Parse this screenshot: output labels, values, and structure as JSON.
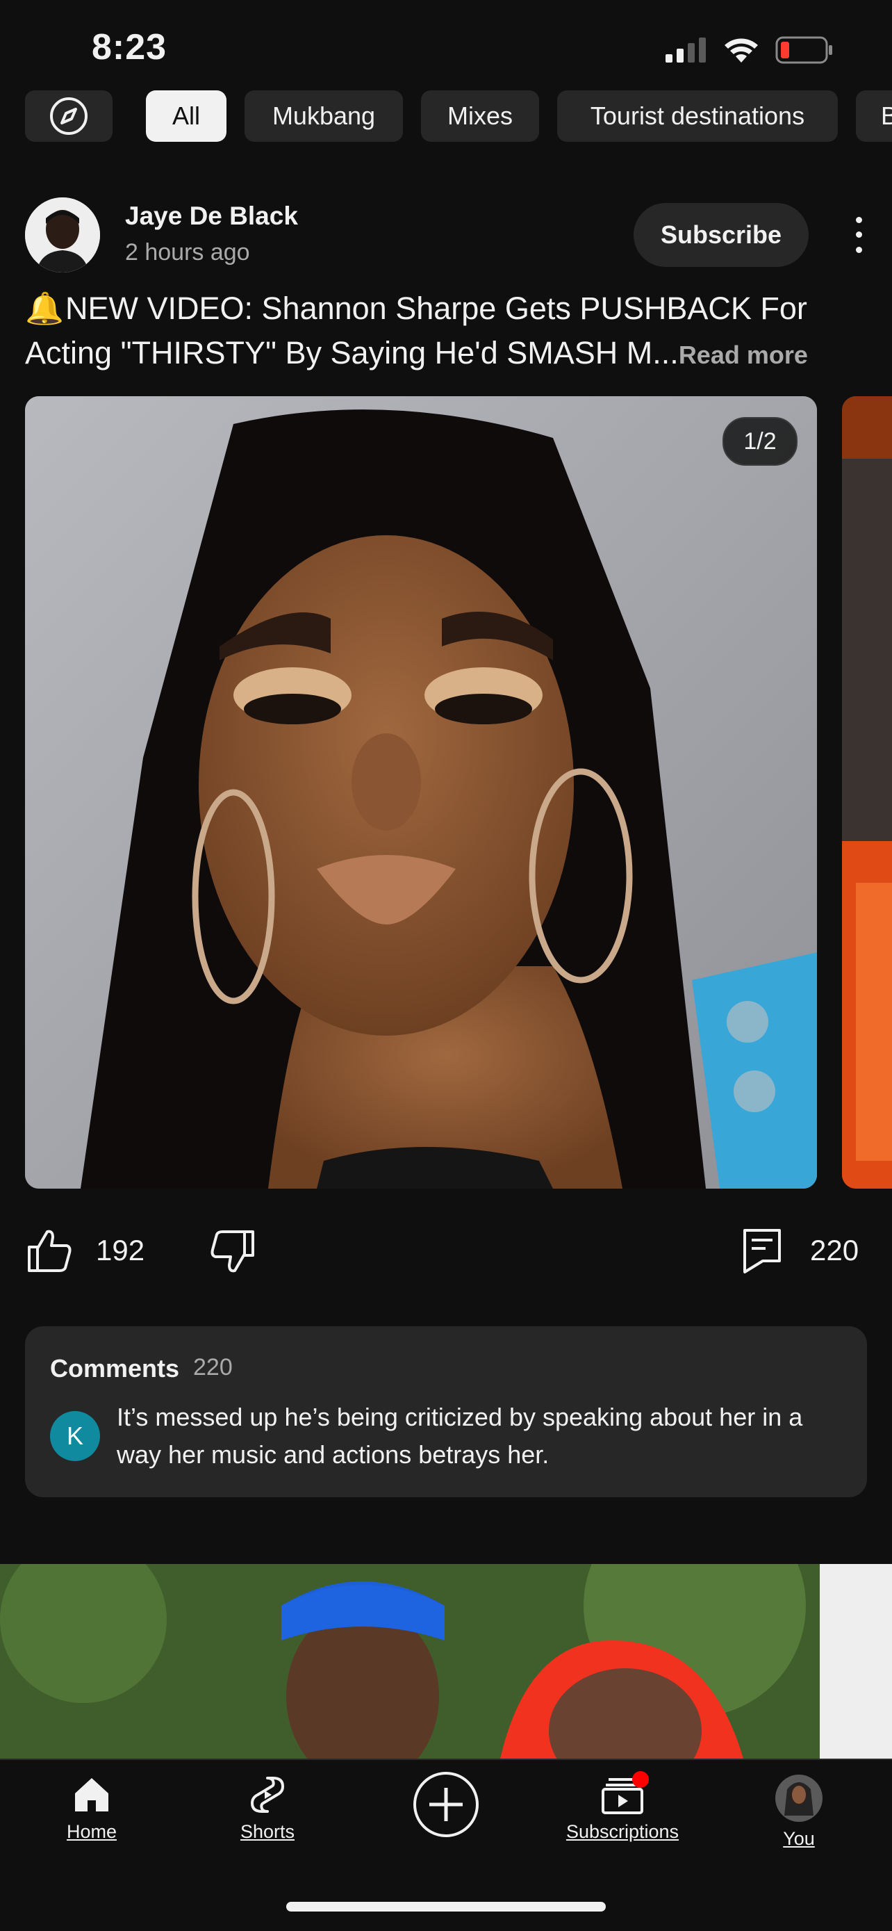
{
  "status_bar": {
    "time": "8:23"
  },
  "chips": [
    {
      "label": "",
      "icon": "explore-compass-icon"
    },
    {
      "label": "All",
      "active": true
    },
    {
      "label": "Mukbang"
    },
    {
      "label": "Mixes"
    },
    {
      "label": "Tourist destinations"
    },
    {
      "label": "B"
    }
  ],
  "post": {
    "channel_name": "Jaye De Black",
    "time_ago": "2 hours ago",
    "subscribe_label": "Subscribe",
    "text": "NEW VIDEO: Shannon Sharpe Gets PUSHBACK For Acting \"THIRSTY\" By Saying He'd SMASH M...",
    "bell_emoji": "🔔",
    "read_more": "Read more",
    "image_counter": "1/2",
    "likes": "192",
    "comments_count": "220"
  },
  "comments": {
    "title": "Comments",
    "count": "220",
    "top_comment": {
      "avatar_letter": "K",
      "text": "It’s messed up he’s being criticized by speaking about her in a way her music and actions betrays her."
    }
  },
  "nav": {
    "items": [
      {
        "label": "Home",
        "icon": "home-icon",
        "active": true
      },
      {
        "label": "Shorts",
        "icon": "shorts-icon"
      },
      {
        "label": "",
        "icon": "create-plus-icon"
      },
      {
        "label": "Subscriptions",
        "icon": "subscriptions-icon",
        "badge": true
      },
      {
        "label": "You",
        "icon": "profile-avatar"
      }
    ]
  },
  "colors": {
    "background": "#0f0f0f",
    "chip": "#272727",
    "notification": "#ff0000",
    "battery_low": "#ff3b30"
  }
}
